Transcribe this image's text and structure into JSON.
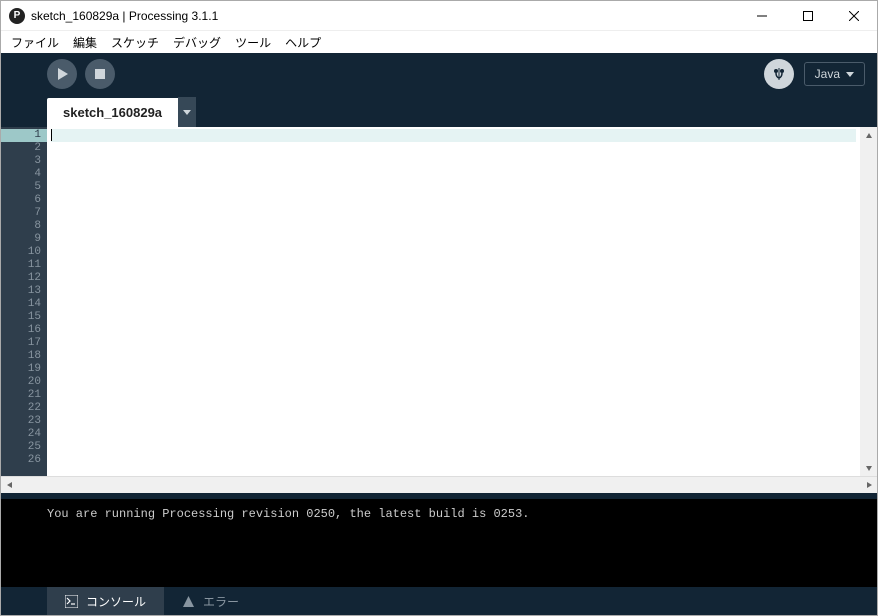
{
  "window": {
    "title": "sketch_160829a | Processing 3.1.1"
  },
  "menu": {
    "file": "ファイル",
    "edit": "編集",
    "sketch": "スケッチ",
    "debug": "デバッグ",
    "tools": "ツール",
    "help": "ヘルプ"
  },
  "toolbar": {
    "mode": "Java"
  },
  "tab": {
    "name": "sketch_160829a"
  },
  "editor": {
    "line_count": 26
  },
  "console": {
    "message": "You are running Processing revision 0250, the latest build is 0253."
  },
  "bottom_tabs": {
    "console": "コンソール",
    "errors": "エラー"
  }
}
